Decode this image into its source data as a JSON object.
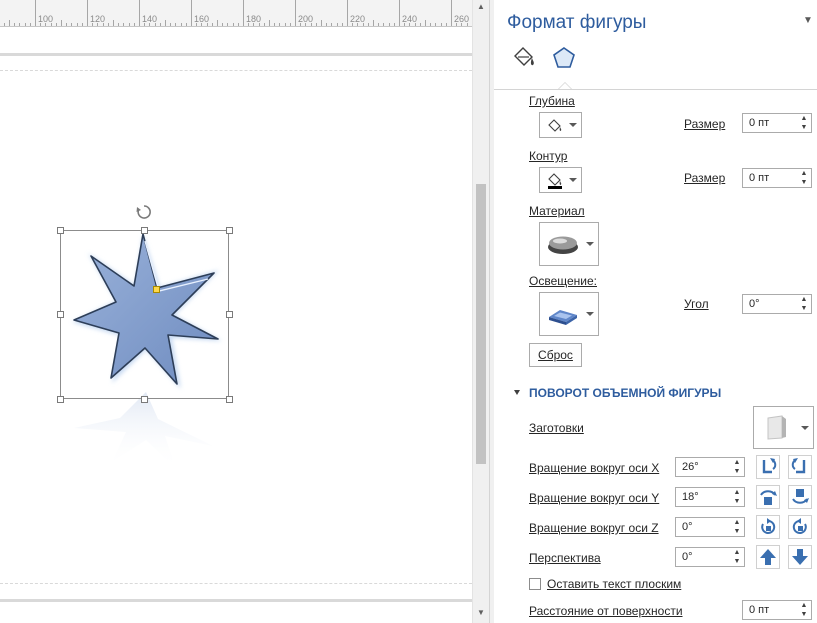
{
  "ruler": {
    "labels": [
      "100",
      "120",
      "140",
      "160",
      "180",
      "200",
      "220",
      "240",
      "260"
    ]
  },
  "pane": {
    "title": "Формат фигуры",
    "tabs": [
      {
        "name": "fill-line-tab",
        "icon": "paint-bucket-icon"
      },
      {
        "name": "effects-tab",
        "icon": "pentagon-icon",
        "active": true
      }
    ],
    "depth": {
      "label": "Глубина",
      "size_label": "Размер",
      "size_value": "0 пт"
    },
    "contour": {
      "label": "Контур",
      "size_label": "Размер",
      "size_value": "0 пт"
    },
    "material": {
      "label": "Материал"
    },
    "lighting": {
      "label": "Освещение:",
      "angle_label": "Угол",
      "angle_value": "0°"
    },
    "reset_label": "Сброс",
    "rotation": {
      "section_title": "ПОВОРОТ ОБЪЕМНОЙ ФИГУРЫ",
      "presets_label": "Заготовки",
      "x_label": "Вращение вокруг оси X",
      "x_value": "26°",
      "y_label": "Вращение вокруг оси Y",
      "y_value": "18°",
      "z_label": "Вращение вокруг оси Z",
      "z_value": "0°",
      "perspective_label": "Перспектива",
      "perspective_value": "0°",
      "keep_flat_label": "Оставить текст плоским",
      "keep_flat_checked": false,
      "distance_label": "Расстояние от поверхности",
      "distance_value": "0 пт"
    }
  },
  "colors": {
    "accent": "#2e5c9e",
    "star_fill": "#7b97c6",
    "icon_blue": "#3a6fb0"
  }
}
